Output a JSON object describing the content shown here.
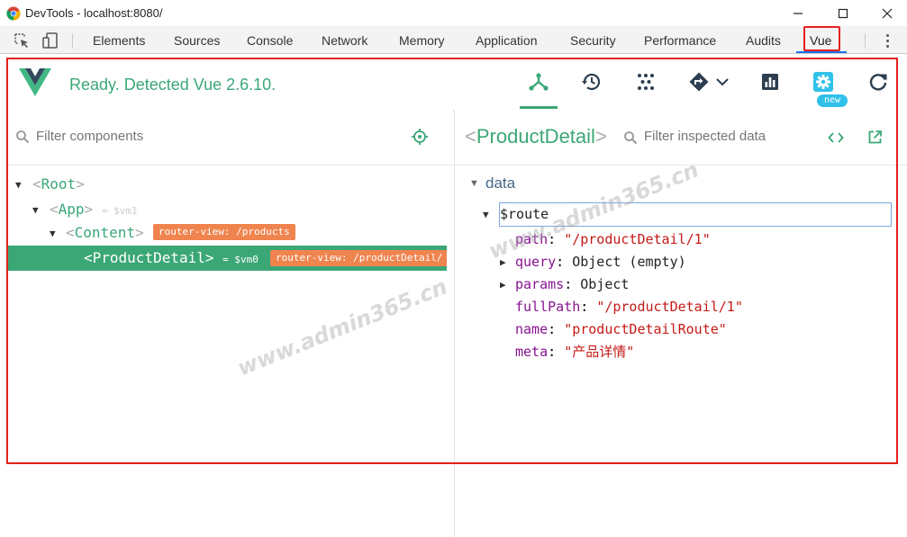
{
  "window": {
    "title": "DevTools - localhost:8080/"
  },
  "devtools_tabs": [
    "Elements",
    "Sources",
    "Console",
    "Network",
    "Memory",
    "Application",
    "Security",
    "Performance",
    "Audits",
    "Vue"
  ],
  "vue_header": {
    "status": "Ready. Detected Vue 2.6.10.",
    "new_badge": "new"
  },
  "components_pane": {
    "filter_placeholder": "Filter components",
    "tree": {
      "root": "Root",
      "app": "App",
      "app_vm": "= $vm1",
      "content": "Content",
      "content_badge": "router-view: /products",
      "selected": "ProductDetail",
      "selected_vm": "= $vm0",
      "selected_badge": "router-view: /productDetail/"
    }
  },
  "inspector": {
    "component_name": "ProductDetail",
    "filter_placeholder": "Filter inspected data",
    "section": "data",
    "route_key": "$route",
    "fields": [
      {
        "key": "path",
        "value": "\"/productDetail/1\"",
        "kind": "str",
        "expandable": false
      },
      {
        "key": "query",
        "value": "Object (empty)",
        "kind": "obj",
        "expandable": true
      },
      {
        "key": "params",
        "value": "Object",
        "kind": "obj",
        "expandable": true
      },
      {
        "key": "fullPath",
        "value": "\"/productDetail/1\"",
        "kind": "str",
        "expandable": false
      },
      {
        "key": "name",
        "value": "\"productDetailRoute\"",
        "kind": "str",
        "expandable": false
      },
      {
        "key": "meta",
        "value": "\"产品详情\"",
        "kind": "str",
        "expandable": false
      }
    ]
  },
  "watermark": "www.admin365.cn",
  "colors": {
    "vue_green": "#3ba776",
    "annotation_red": "#e3201d",
    "badge_orange": "#f0844f",
    "badge_blue": "#2fc1ea"
  }
}
